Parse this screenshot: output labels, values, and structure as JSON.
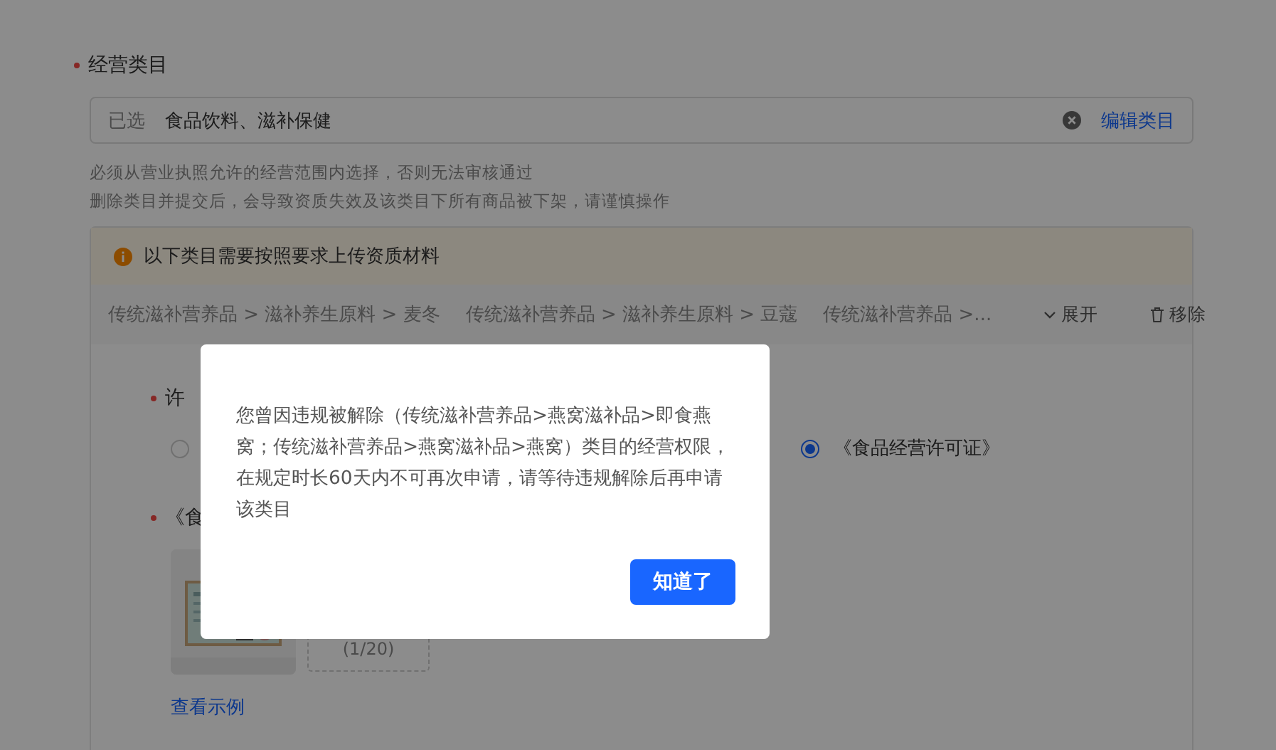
{
  "form": {
    "category_field": {
      "label": "经营类目",
      "required": true,
      "prefix": "已选",
      "value": "食品饮料、滋补保健",
      "edit_link": "编辑类目"
    },
    "hints": [
      "必须从营业执照允许的经营范围内选择，否则无法审核通过",
      "删除类目并提交后，会导致资质失效及该类目下所有商品被下架，请谨慎操作"
    ],
    "notice": {
      "message": "以下类目需要按照要求上传资质材料",
      "categories": [
        "传统滋补营养品 > 滋补养生原料 > 麦冬",
        "传统滋补营养品 > 滋补养生原料 > 豆蔻",
        "传统滋补营养品 >..."
      ],
      "expand": "展开",
      "remove": "移除"
    },
    "license": {
      "label": "许",
      "required": true,
      "options": [
        {
          "selected": false
        },
        {
          "label": "《食品经营许可证》",
          "selected": true
        }
      ],
      "upload_label": "《食",
      "upload_required": true,
      "upload_count": "(1/20)",
      "example_link": "查看示例"
    }
  },
  "dialog": {
    "message": "您曾因违规被解除（传统滋补营养品>燕窝滋补品>即食燕窝；传统滋补营养品>燕窝滋补品>燕窝）类目的经营权限，在规定时长60天内不可再次申请，请等待违规解除后再申请该类目",
    "button": "知道了"
  }
}
